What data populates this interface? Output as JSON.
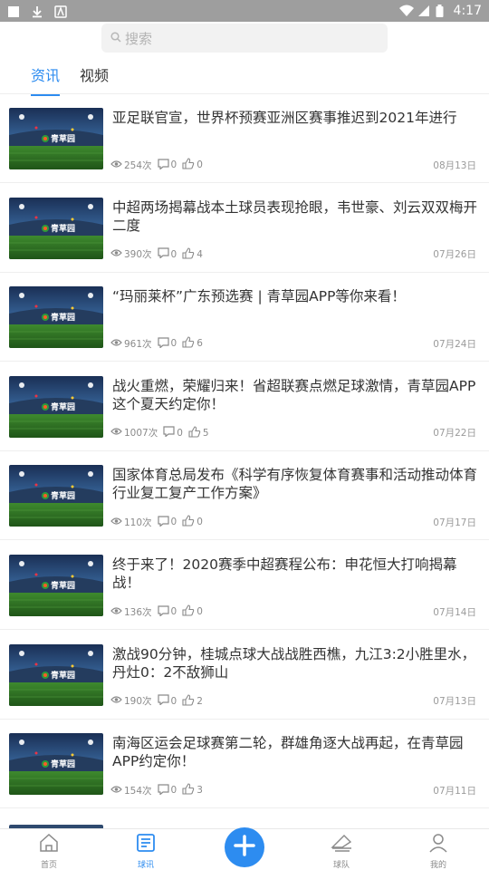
{
  "status_bar": {
    "time": "4:17"
  },
  "search": {
    "placeholder": "搜索"
  },
  "tabs": [
    {
      "label": "资讯",
      "active": true
    },
    {
      "label": "视频",
      "active": false
    }
  ],
  "thumbnail_logo_text": "青草园",
  "articles": [
    {
      "title": "亚足联官宣，世界杯预赛亚洲区赛事推迟到2021年进行",
      "views": "254次",
      "comments": "0",
      "likes": "0",
      "date": "08月13日"
    },
    {
      "title": "中超两场揭幕战本土球员表现抢眼，韦世豪、刘云双双梅开二度",
      "views": "390次",
      "comments": "0",
      "likes": "4",
      "date": "07月26日"
    },
    {
      "title": "“玛丽莱杯”广东预选赛 | 青草园APP等你来看！",
      "views": "961次",
      "comments": "0",
      "likes": "6",
      "date": "07月24日"
    },
    {
      "title": "战火重燃，荣耀归来！省超联赛点燃足球激情，青草园APP这个夏天约定你！",
      "views": "1007次",
      "comments": "0",
      "likes": "5",
      "date": "07月22日"
    },
    {
      "title": "国家体育总局发布《科学有序恢复体育赛事和活动推动体育行业复工复产工作方案》",
      "views": "110次",
      "comments": "0",
      "likes": "0",
      "date": "07月17日"
    },
    {
      "title": "终于来了！2020赛季中超赛程公布：申花恒大打响揭幕战！",
      "views": "136次",
      "comments": "0",
      "likes": "0",
      "date": "07月14日"
    },
    {
      "title": "激战90分钟，桂城点球大战战胜西樵，九江3:2小胜里水，丹灶0：2不敌狮山",
      "views": "190次",
      "comments": "0",
      "likes": "2",
      "date": "07月13日"
    },
    {
      "title": "南海区运会足球赛第二轮，群雄角逐大战再起，在青草园APP约定你！",
      "views": "154次",
      "comments": "0",
      "likes": "3",
      "date": "07月11日"
    }
  ],
  "tabbar": {
    "items": [
      {
        "label": "首页",
        "icon": "home-icon",
        "active": false
      },
      {
        "label": "球讯",
        "icon": "news-icon",
        "active": true
      },
      {
        "label": "球队",
        "icon": "team-icon",
        "active": false
      },
      {
        "label": "我的",
        "icon": "profile-icon",
        "active": false
      }
    ],
    "fab_icon": "plus-icon"
  },
  "colors": {
    "accent": "#2d8cf0",
    "status_bar": "#9e9e9e"
  }
}
